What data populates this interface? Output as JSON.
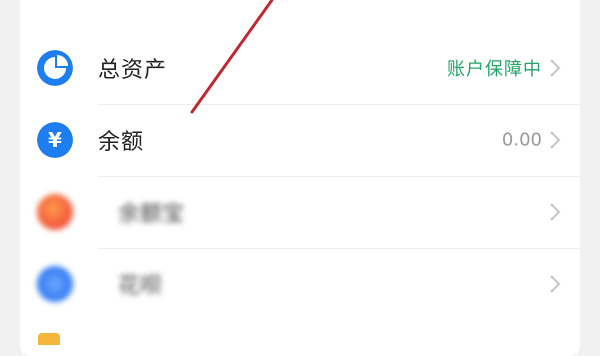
{
  "rows": [
    {
      "id": "total-assets",
      "label": "总资产",
      "value": "账户保障中",
      "icon": "pie-chart-icon"
    },
    {
      "id": "balance",
      "label": "余额",
      "value": "0.00",
      "icon": "yuan-icon",
      "icon_glyph": "¥"
    },
    {
      "id": "blurred-1",
      "label": "余额宝",
      "value": "",
      "icon": "blurred-orange-icon"
    },
    {
      "id": "blurred-2",
      "label": "花呗",
      "value": "",
      "icon": "blurred-blue-icon"
    }
  ],
  "colors": {
    "accent_blue": "#1e7ef0",
    "status_green": "#24a36b",
    "annotation_red": "#c0282f"
  }
}
